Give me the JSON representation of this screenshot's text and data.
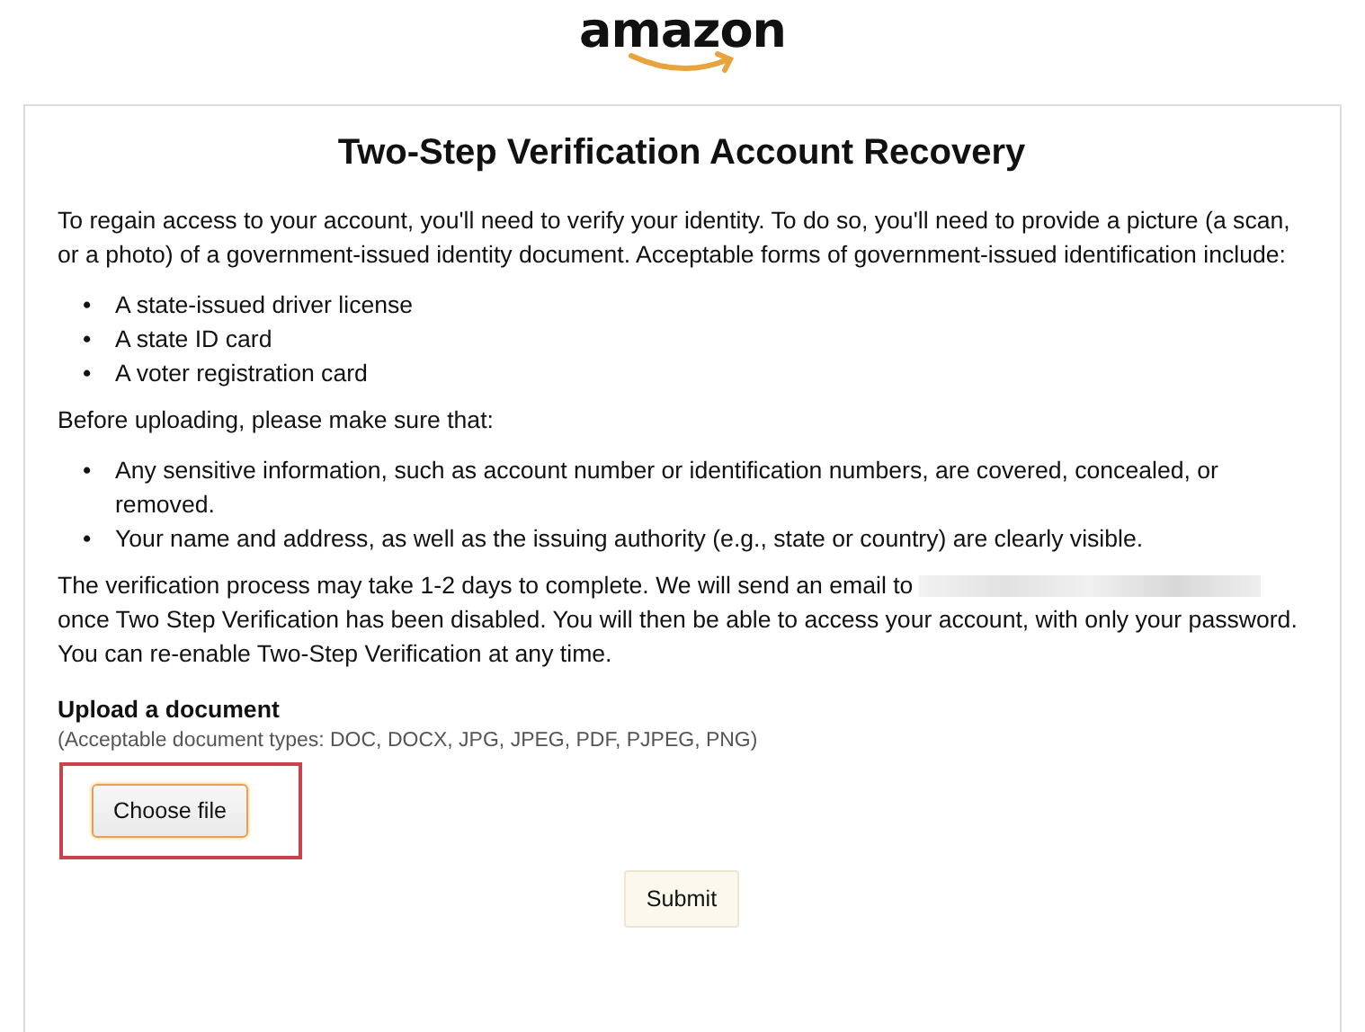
{
  "logo": {
    "text": "amazon"
  },
  "title": "Two-Step Verification Account Recovery",
  "intro": "To regain access to your account, you'll need to verify your identity. To do so, you'll need to provide a picture (a scan, or a photo) of a government-issued identity document. Acceptable forms of government-issued identification include:",
  "documents": [
    {
      "bullet": "•",
      "text": "A state-issued driver license"
    },
    {
      "bullet": "•",
      "text": "A state ID card"
    },
    {
      "bullet": "•",
      "text": "A voter registration card"
    }
  ],
  "before_text": "Before uploading, please make sure that:",
  "conditions": [
    {
      "bullet": "•",
      "text": "Any sensitive information, such as account number or identification numbers, are covered, concealed, or removed."
    },
    {
      "bullet": "•",
      "text": "Your name and address, as well as the issuing authority (e.g., state or country) are clearly visible."
    }
  ],
  "verification": {
    "start": "The verification process may take 1-2 days to complete. We will send an email to",
    "end": "once Two Step Verification has been disabled. You will then be able to access your account, with only your password. You can re-enable Two-Step Verification at any time."
  },
  "upload": {
    "label": "Upload a document",
    "hint": "(Acceptable document types: DOC, DOCX, JPG, JPEG, PDF, PJPEG, PNG)",
    "button": "Choose file",
    "highlighted": true
  },
  "submit": "Submit"
}
